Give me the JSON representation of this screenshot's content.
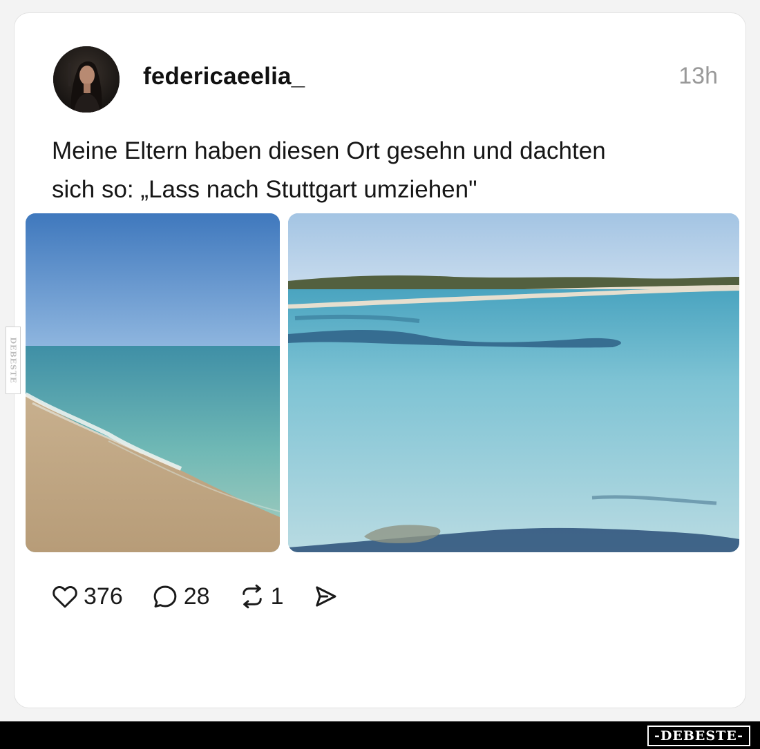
{
  "post": {
    "username": "federicaeelia_",
    "timestamp": "13h",
    "text_lines": [
      "Meine Eltern haben diesen Ort gesehn und dachten",
      "sich so: „Lass nach Stuttgart umziehen\""
    ]
  },
  "actions": {
    "likes": "376",
    "comments": "28",
    "reposts": "1"
  },
  "icons": {
    "like": "heart-icon",
    "comment": "comment-bubble-icon",
    "repost": "repost-icon",
    "share": "send-icon"
  },
  "watermark": {
    "side": "DEBESTE",
    "footer": "-DEBESTE-"
  },
  "colors": {
    "sky": "#4f86c6",
    "sea": "#78c2cf",
    "sand": "#c9b08c",
    "footer": "#000000"
  }
}
